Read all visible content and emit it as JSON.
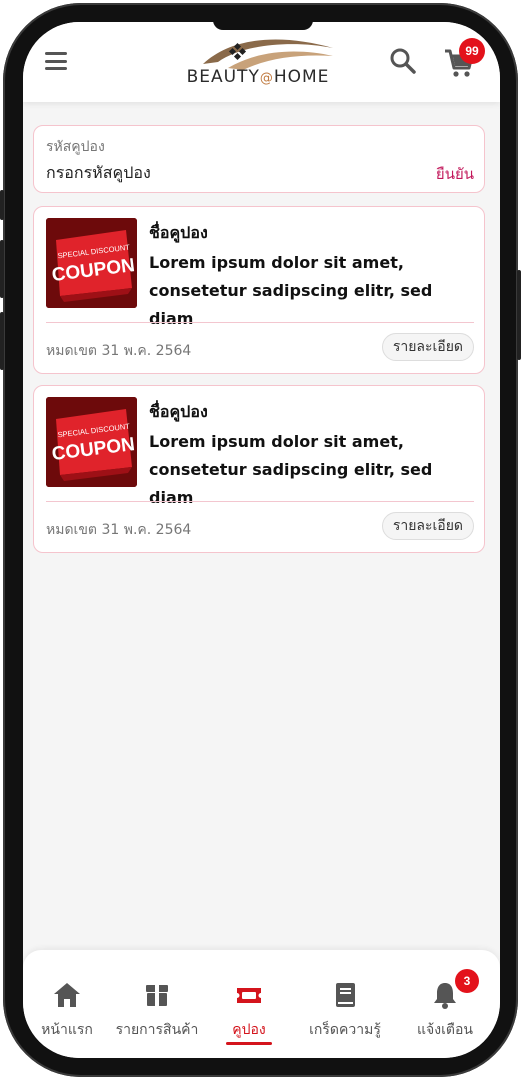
{
  "header": {
    "logo_text_left": "BEAUTY",
    "logo_text_at": "@",
    "logo_text_right": "HOME",
    "cart_count": "99",
    "icons": [
      "menu-icon",
      "search-icon",
      "cart-icon"
    ]
  },
  "coupon_code": {
    "label": "รหัสคูปอง",
    "placeholder": "กรอกรหัสคูปอง",
    "confirm_label": "ยืนยัน"
  },
  "coupons": [
    {
      "title": "ชื่อคูปอง",
      "description": "Lorem ipsum dolor sit amet, consetetur sadipscing elitr, sed diam",
      "image_text_top": "SPECIAL DISCOUNT",
      "image_text_main": "COUPON",
      "expiry": "หมดเขต 31 พ.ค. 2564",
      "detail_label": "รายละเอียด"
    },
    {
      "title": "ชื่อคูปอง",
      "description": "Lorem ipsum dolor sit amet, consetetur sadipscing elitr, sed diam",
      "image_text_top": "SPECIAL DISCOUNT",
      "image_text_main": "COUPON",
      "expiry": "หมดเขต 31 พ.ค. 2564",
      "detail_label": "รายละเอียด"
    }
  ],
  "bottom_nav": {
    "items": [
      {
        "label": "หน้าแรก",
        "icon": "home-icon",
        "active": false
      },
      {
        "label": "รายการสินค้า",
        "icon": "box-icon",
        "active": false
      },
      {
        "label": "คูปอง",
        "icon": "ticket-icon",
        "active": true
      },
      {
        "label": "เกร็ดความรู้",
        "icon": "book-icon",
        "active": false
      },
      {
        "label": "แจ้งเตือน",
        "icon": "bell-icon",
        "active": false,
        "badge": "3"
      }
    ]
  },
  "colors": {
    "accent": "#d4141c",
    "confirm_text": "#c2185b",
    "card_border": "#f5c4cd",
    "background": "#f5f5f5"
  }
}
